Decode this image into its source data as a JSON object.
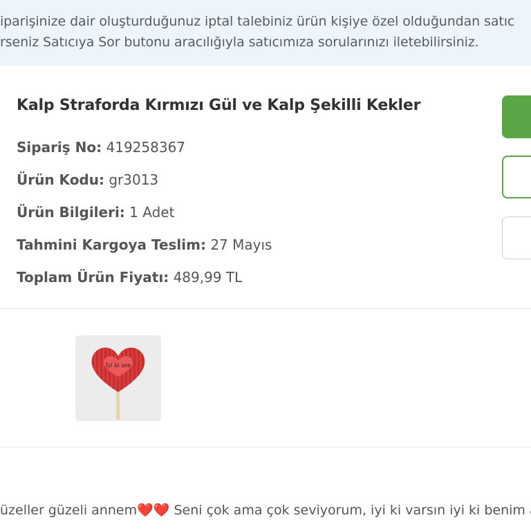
{
  "notice": {
    "line1": "iparişinize dair oluşturduğunuz iptal talebiniz ürün kişiye özel olduğundan satıc",
    "line2": "rseniz Satıcıya Sor butonu aracılığıyla satıcımıza sorularınızı iletebilirsiniz."
  },
  "product": {
    "title": "Kalp Straforda Kırmızı Gül ve Kalp Şekilli Kekler",
    "order_no_label": "Sipariş No:",
    "order_no": "419258367",
    "code_label": "Ürün Kodu:",
    "code": "gr3013",
    "info_label": "Ürün Bilgileri:",
    "info": "1 Adet",
    "delivery_label": "Tahmini Kargoya Teslim:",
    "delivery": "27 Mayıs",
    "price_label": "Toplam Ürün Fiyatı:",
    "price": "489,99 TL"
  },
  "image": {
    "heart_text": "İyi ki sen"
  },
  "message": {
    "text_before": "üzeller güzeli annem",
    "emoji": "❤️❤️",
    "text_after": " Seni çok ama çok seviyorum, iyi ki varsın iyi ki benim a"
  },
  "colors": {
    "accent_green": "#5aa545",
    "notice_bg": "#eef4fb",
    "heart_red": "#e53935"
  }
}
